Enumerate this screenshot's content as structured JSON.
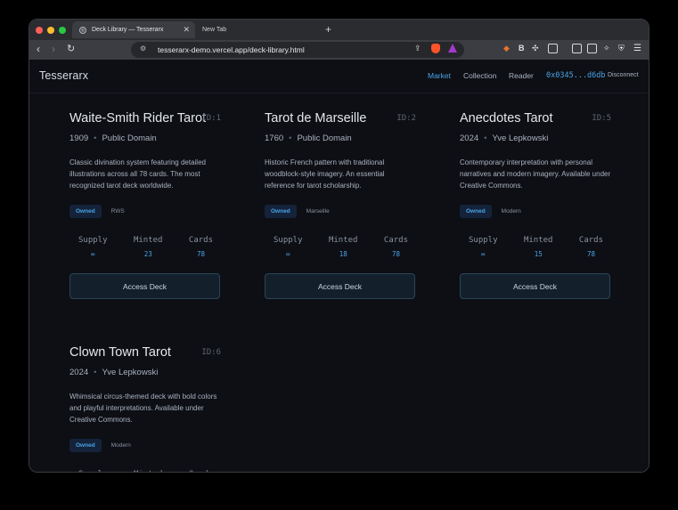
{
  "browser": {
    "tabs": [
      {
        "title": "Deck Library — Tesserarx",
        "active": true
      },
      {
        "title": "New Tab",
        "active": false
      }
    ],
    "url": "tesserarx-demo.vercel.app/deck-library.html"
  },
  "app": {
    "logo": "Tesserarx",
    "nav": [
      {
        "label": "Market",
        "active": true
      },
      {
        "label": "Collection",
        "active": false
      },
      {
        "label": "Reader",
        "active": false
      }
    ],
    "wallet": "0x0345...d6db",
    "disconnect": "Disconnect"
  },
  "stat_labels": {
    "supply": "Supply",
    "minted": "Minted",
    "cards": "Cards"
  },
  "access_label": "Access Deck",
  "decks": [
    {
      "title": "Waite-Smith Rider Tarot",
      "id": "ID:1",
      "year": "1909",
      "author": "Public Domain",
      "description": "Classic divination system featuring detailed illustrations across all 78 cards. The most recognized tarot deck worldwide.",
      "owned": "Owned",
      "type": "RWS",
      "supply": "∞",
      "minted": "23",
      "cards": "78"
    },
    {
      "title": "Tarot de Marseille",
      "id": "ID:2",
      "year": "1760",
      "author": "Public Domain",
      "description": "Historic French pattern with traditional woodblock-style imagery. An essential reference for tarot scholarship.",
      "owned": "Owned",
      "type": "Marseille",
      "supply": "∞",
      "minted": "18",
      "cards": "78"
    },
    {
      "title": "Anecdotes Tarot",
      "id": "ID:5",
      "year": "2024",
      "author": "Yve Lepkowski",
      "description": "Contemporary interpretation with personal narratives and modern imagery. Available under Creative Commons.",
      "owned": "Owned",
      "type": "Modern",
      "supply": "∞",
      "minted": "15",
      "cards": "78"
    },
    {
      "title": "Clown Town Tarot",
      "id": "ID:6",
      "year": "2024",
      "author": "Yve Lepkowski",
      "description": "Whimsical circus-themed deck with bold colors and playful interpretations. Available under Creative Commons.",
      "owned": "Owned",
      "type": "Modern",
      "supply": "",
      "minted": "",
      "cards": ""
    }
  ]
}
